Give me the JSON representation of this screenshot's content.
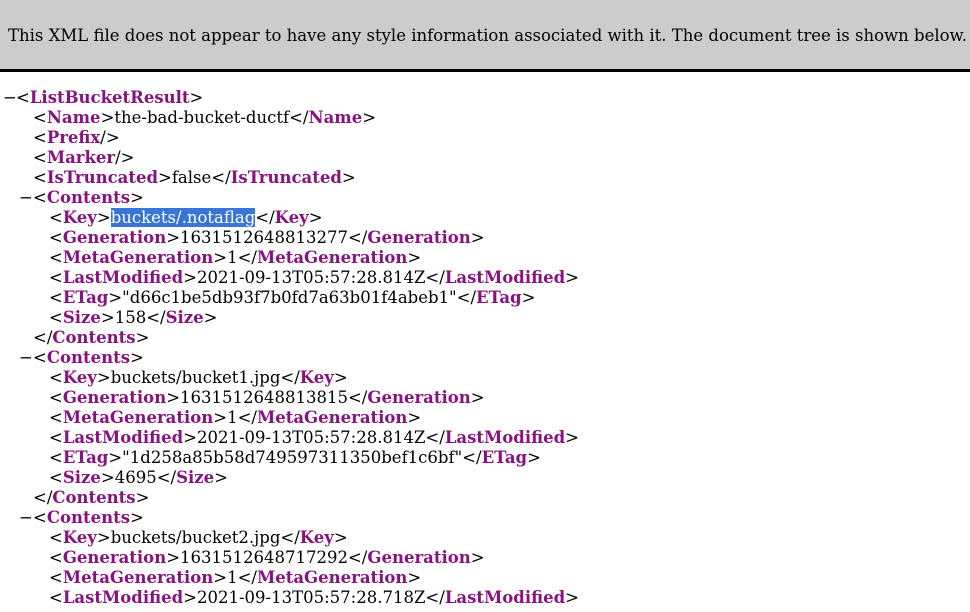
{
  "info": "This XML file does not appear to have any style information associated with it. The document tree is shown below.",
  "toggle_symbol": "−",
  "root_tag": "ListBucketResult",
  "name": {
    "tag": "Name",
    "value": "the-bad-bucket-ductf"
  },
  "prefix_tag": "Prefix",
  "marker_tag": "Marker",
  "is_truncated": {
    "tag": "IsTruncated",
    "value": "false"
  },
  "contents_tag": "Contents",
  "field_tags": {
    "key": "Key",
    "generation": "Generation",
    "meta_generation": "MetaGeneration",
    "last_modified": "LastModified",
    "etag": "ETag",
    "size": "Size"
  },
  "contents": [
    {
      "key": "buckets/.notaflag",
      "generation": "1631512648813277",
      "meta_generation": "1",
      "last_modified": "2021-09-13T05:57:28.814Z",
      "etag": "\"d66c1be5db93f7b0fd7a63b01f4abeb1\"",
      "size": "158"
    },
    {
      "key": "buckets/bucket1.jpg",
      "generation": "1631512648813815",
      "meta_generation": "1",
      "last_modified": "2021-09-13T05:57:28.814Z",
      "etag": "\"1d258a85b58d749597311350bef1c6bf\"",
      "size": "4695"
    },
    {
      "key": "buckets/bucket2.jpg",
      "generation": "1631512648717292",
      "meta_generation": "1",
      "last_modified": "2021-09-13T05:57:28.718Z"
    }
  ]
}
